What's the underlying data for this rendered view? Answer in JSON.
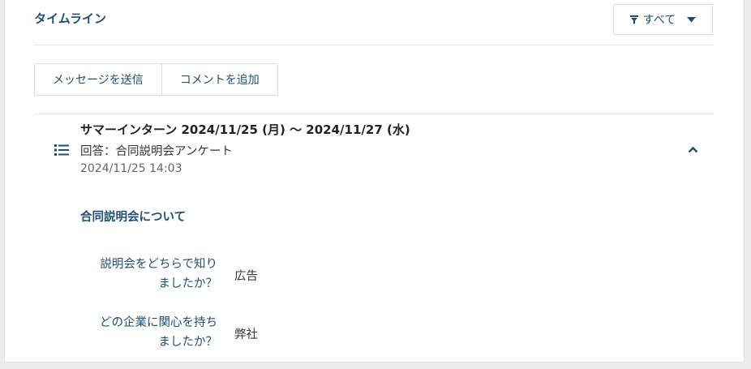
{
  "timeline": {
    "title": "タイムライン",
    "filter": {
      "label": "すべて",
      "icon": "filter-icon"
    }
  },
  "actions": {
    "send_message": "メッセージを送信",
    "add_comment": "コメントを追加"
  },
  "entry": {
    "title": "サマーインターン 2024/11/25 (月) ～ 2024/11/27 (水)",
    "subtitle": "回答：合同説明会アンケート",
    "datetime": "2024/11/25 14:03",
    "icon": "list-icon",
    "section_title": "合同説明会について",
    "qa": [
      {
        "q_line1": "説明会をどちらで知り",
        "q_line2": "ましたか？",
        "answer": "広告"
      },
      {
        "q_line1": "どの企業に関心を持ち",
        "q_line2": "ましたか？",
        "answer": "弊社"
      }
    ]
  },
  "colors": {
    "accent": "#1d4f73",
    "divider": "#e6e6e6",
    "border": "#dcdcdc"
  }
}
